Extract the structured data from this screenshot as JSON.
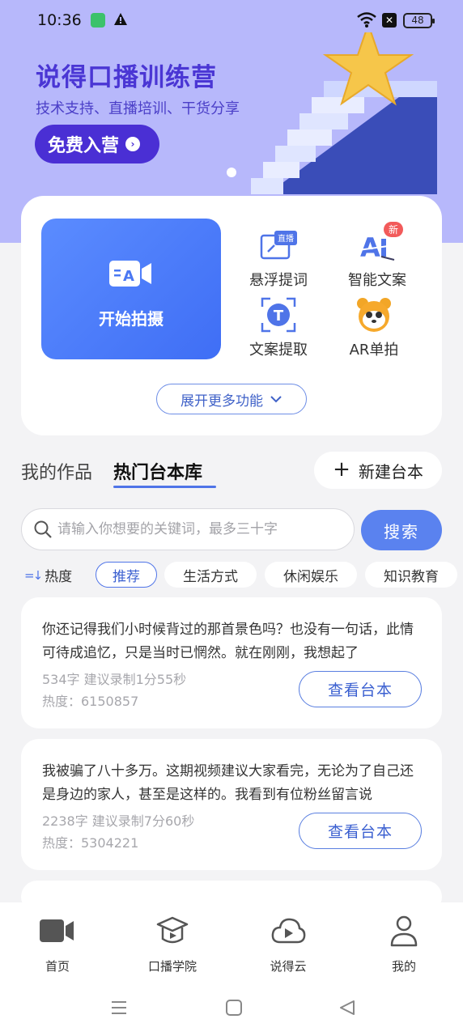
{
  "status_bar": {
    "time": "10:36",
    "battery": "48"
  },
  "banner": {
    "title": "说得口播训练营",
    "subtitle": "技术支持、直播培训、干货分享",
    "cta_label": "免费入营"
  },
  "features": {
    "main": {
      "label": "开始拍摄"
    },
    "items": [
      {
        "label": "悬浮提词",
        "icon": "floating-prompter-icon",
        "badge": "直播"
      },
      {
        "label": "智能文案",
        "icon": "ai-copywriting-icon",
        "badge": "新"
      },
      {
        "label": "文案提取",
        "icon": "text-extract-icon"
      },
      {
        "label": "AR单拍",
        "icon": "ar-panda-icon"
      }
    ],
    "expand_label": "展开更多功能"
  },
  "tabs": {
    "mine": "我的作品",
    "hot": "热门台本库",
    "new_script": "新建台本"
  },
  "search": {
    "placeholder": "请输入你想要的关键词，最多三十字",
    "button": "搜索"
  },
  "filters": {
    "sort_label": "热度",
    "chips": [
      "推荐",
      "生活方式",
      "休闲娱乐",
      "知识教育"
    ],
    "active": "推荐"
  },
  "scripts": [
    {
      "text": "你还记得我们小时候背过的那首景色吗？也没有一句话，此情可待成追忆，只是当时已惘然。就在刚刚，我想起了",
      "meta": "534字 建议录制1分55秒",
      "heat": "热度：6150857",
      "button": "查看台本"
    },
    {
      "text": "我被骗了八十多万。这期视频建议大家看完，无论为了自己还是身边的家人，甚至是这样的。我看到有位粉丝留言说",
      "meta": "2238字 建议录制7分60秒",
      "heat": "热度：5304221",
      "button": "查看台本"
    }
  ],
  "bottom_nav": [
    {
      "label": "首页",
      "icon": "video-camera-icon"
    },
    {
      "label": "口播学院",
      "icon": "graduation-cap-icon"
    },
    {
      "label": "说得云",
      "icon": "cloud-play-icon"
    },
    {
      "label": "我的",
      "icon": "person-icon"
    }
  ],
  "colors": {
    "banner_bg": "#b7b8fb",
    "accent": "#5a82ef",
    "brand_purple": "#4a2fd4"
  }
}
